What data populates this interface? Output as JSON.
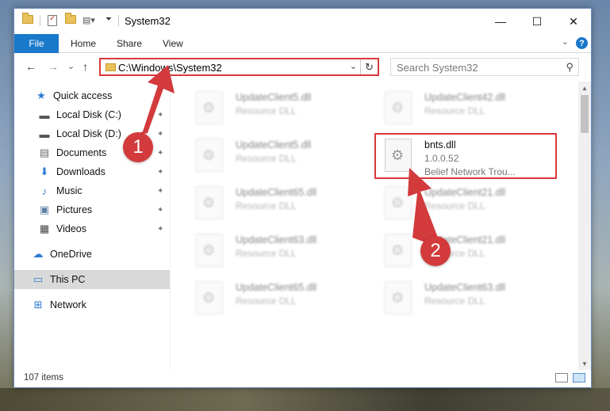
{
  "window": {
    "title": "System32",
    "minimize_glyph": "—",
    "maximize_glyph": "☐",
    "close_glyph": "✕"
  },
  "ribbon": {
    "tabs": [
      "File",
      "Home",
      "Share",
      "View"
    ],
    "expand_glyph": "⌄",
    "help_glyph": "?"
  },
  "address": {
    "back_glyph": "←",
    "forward_glyph": "→",
    "recent_glyph": "⌄",
    "up_glyph": "↑",
    "path": "C:\\Windows\\System32",
    "dropdown_glyph": "⌄",
    "refresh_glyph": "↻"
  },
  "search": {
    "placeholder": "Search System32",
    "icon_glyph": "⚲"
  },
  "sidebar": {
    "items": [
      {
        "label": "Quick access",
        "icon": "star-icon",
        "glyph": "★",
        "color": "#2b7bd2"
      },
      {
        "label": "Local Disk (C:)",
        "icon": "drive-icon",
        "glyph": "▬",
        "color": "#555555",
        "pinned": true
      },
      {
        "label": "Local Disk (D:)",
        "icon": "drive-icon",
        "glyph": "▬",
        "color": "#555555",
        "pinned": true
      },
      {
        "label": "Documents",
        "icon": "documents-icon",
        "glyph": "▤",
        "color": "#6b6b6b",
        "pinned": true
      },
      {
        "label": "Downloads",
        "icon": "download-icon",
        "glyph": "⬇",
        "color": "#2b7bd2",
        "pinned": true
      },
      {
        "label": "Music",
        "icon": "music-icon",
        "glyph": "♪",
        "color": "#2b7bd2",
        "pinned": true
      },
      {
        "label": "Pictures",
        "icon": "pictures-icon",
        "glyph": "▣",
        "color": "#5d7fa6",
        "pinned": true
      },
      {
        "label": "Videos",
        "icon": "videos-icon",
        "glyph": "▦",
        "color": "#444444",
        "pinned": true
      },
      {
        "label": "OneDrive",
        "icon": "cloud-icon",
        "glyph": "☁",
        "color": "#2b7bd2"
      },
      {
        "label": "This PC",
        "icon": "computer-icon",
        "glyph": "▭",
        "color": "#2b7bd2",
        "selected": true
      },
      {
        "label": "Network",
        "icon": "network-icon",
        "glyph": "⊞",
        "color": "#2b7bd2"
      }
    ],
    "pin_glyph": "📌"
  },
  "files": [
    {
      "name": "UpdateClient5.dll",
      "type": "Resource DLL"
    },
    {
      "name": "UpdateClient42.dll",
      "type": "Resource DLL"
    },
    {
      "name": "UpdateClient5.dll",
      "type": "Resource DLL"
    },
    {
      "name": "bnts.dll",
      "version": "1.0.0.52",
      "description": "Belief Network Trou...",
      "highlighted": true
    },
    {
      "name": "UpdateClient65.dll",
      "type": "Resource DLL"
    },
    {
      "name": "UpdateClient21.dll",
      "type": "Resource DLL"
    },
    {
      "name": "UpdateClient63.dll",
      "type": "Resource DLL"
    },
    {
      "name": "UpdateClient21.dll",
      "type": "Resource DLL"
    },
    {
      "name": "UpdateClient65.dll",
      "type": "Resource DLL"
    },
    {
      "name": "UpdateClient63.dll",
      "type": "Resource DLL"
    }
  ],
  "status": {
    "item_count": "107 items"
  },
  "annotations": {
    "step1": "1",
    "step2": "2",
    "color": "#d23a3c"
  }
}
